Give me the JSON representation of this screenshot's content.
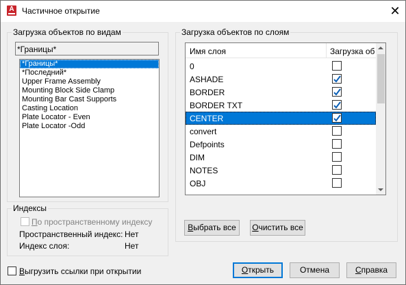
{
  "window": {
    "title": "Частичное открытие",
    "app_icon_letter": "A",
    "close_glyph": "✕"
  },
  "views_group": {
    "label": "Загрузка объектов по видам",
    "current_view": "*Границы*",
    "items": [
      {
        "label": "*Границы*",
        "selected": true
      },
      {
        "label": "*Последний*",
        "selected": false
      },
      {
        "label": "Upper Frame Assembly",
        "selected": false
      },
      {
        "label": "Mounting Block Side Clamp",
        "selected": false
      },
      {
        "label": "Mounting Bar Cast Supports",
        "selected": false
      },
      {
        "label": "Casting Location",
        "selected": false
      },
      {
        "label": "Plate Locator - Even",
        "selected": false
      },
      {
        "label": "Plate Locator -Odd",
        "selected": false
      }
    ]
  },
  "layers_group": {
    "label": "Загрузка объектов по слоям",
    "col_name": "Имя слоя",
    "col_load": "Загрузка об...",
    "rows": [
      {
        "name": "0",
        "checked": false,
        "selected": false
      },
      {
        "name": "ASHADE",
        "checked": true,
        "selected": false
      },
      {
        "name": "BORDER",
        "checked": true,
        "selected": false
      },
      {
        "name": "BORDER TXT",
        "checked": true,
        "selected": false
      },
      {
        "name": "CENTER",
        "checked": true,
        "selected": true
      },
      {
        "name": "convert",
        "checked": false,
        "selected": false
      },
      {
        "name": "Defpoints",
        "checked": false,
        "selected": false
      },
      {
        "name": "DIM",
        "checked": false,
        "selected": false
      },
      {
        "name": "NOTES",
        "checked": false,
        "selected": false
      },
      {
        "name": "OBJ",
        "checked": false,
        "selected": false
      }
    ],
    "select_all_prefix": "",
    "select_all_u": "В",
    "select_all_rest": "ыбрать все",
    "clear_all_prefix": "",
    "clear_all_u": "О",
    "clear_all_rest": "чистить все"
  },
  "index_group": {
    "label": "Индексы",
    "spatial_checkbox_u": "П",
    "spatial_checkbox_rest": "о пространственному индексу",
    "spatial_index_label": "Пространственный индекс:",
    "spatial_index_value": "Нет",
    "layer_index_label": "Индекс слоя:",
    "layer_index_value": "Нет"
  },
  "footer": {
    "unload_refs_u": "В",
    "unload_refs_rest": "ыгрузить ссылки при открытии",
    "open_u": "О",
    "open_rest": "ткрыть",
    "cancel": "Отмена",
    "help_u": "С",
    "help_rest": "правка"
  },
  "colors": {
    "accent": "#0078d7",
    "check": "#0b5fb5"
  }
}
